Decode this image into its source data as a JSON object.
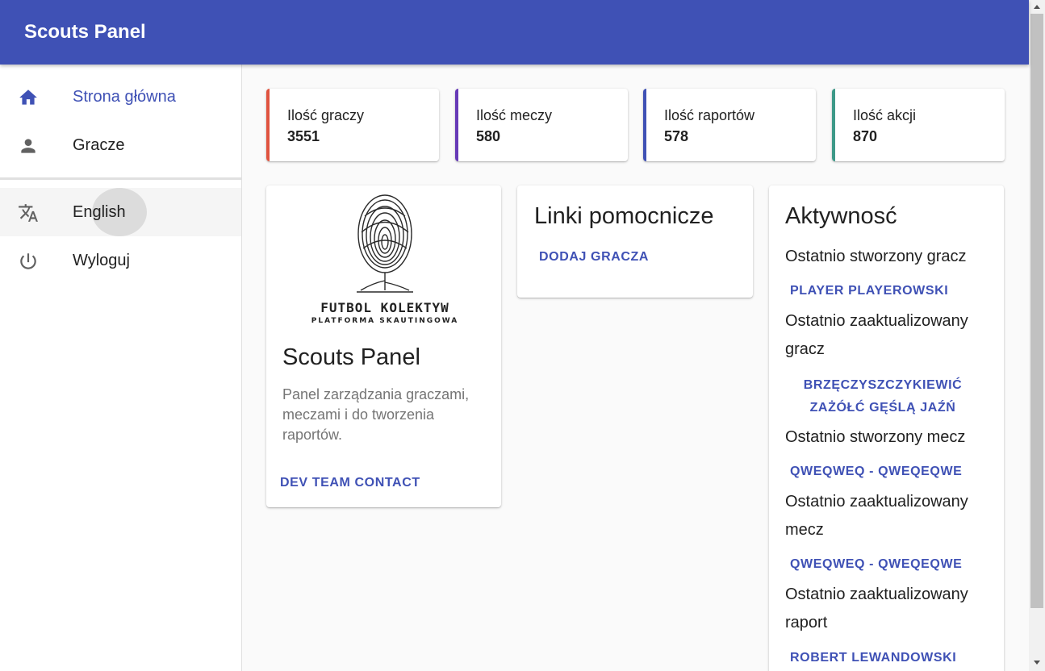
{
  "app": {
    "title": "Scouts Panel"
  },
  "sidebar": {
    "items": [
      {
        "label": "Strona główna",
        "icon": "home-icon",
        "active": true
      },
      {
        "label": "Gracze",
        "icon": "person-icon"
      },
      {
        "label": "English",
        "icon": "translate-icon"
      },
      {
        "label": "Wyloguj",
        "icon": "power-icon"
      }
    ]
  },
  "stats": [
    {
      "label": "Ilość graczy",
      "value": "3551",
      "color": "#e0533f"
    },
    {
      "label": "Ilość meczy",
      "value": "580",
      "color": "#673ab7"
    },
    {
      "label": "Ilość raportów",
      "value": "578",
      "color": "#3f51b5"
    },
    {
      "label": "Ilość akcji",
      "value": "870",
      "color": "#3d9988"
    }
  ],
  "about_card": {
    "logo_word": "FUTBOL KOLEKTYW",
    "logo_sub": "PLATFORMA SKAUTINGOWA",
    "title": "Scouts Panel",
    "description": "Panel zarządzania graczami, meczami i do tworzenia raportów.",
    "button": "Dev team contact"
  },
  "links_card": {
    "title": "Linki pomocnicze",
    "add_player": "Dodaj gracza"
  },
  "activity_card": {
    "title": "Aktywnosć",
    "created_player_label": "Ostatnio stworzony gracz",
    "created_player": "Player Playerowski",
    "updated_player_label": "Ostatnio zaaktualizowany gracz",
    "updated_player": "Brzęczyszczykiewić Zażółć Gęślą Jaźń",
    "created_match_label": "Ostatnio stworzony mecz",
    "created_match": "qweqweq - qweqeqwe",
    "updated_match_label": "Ostatnio zaaktualizowany mecz",
    "updated_match": "qweqweq - qweqeqwe",
    "updated_report_label": "Ostatnio zaaktualizowany raport",
    "updated_report": "Robert Lewandowski"
  },
  "colors": {
    "primary": "#3f51b5",
    "icon_gray": "#616161"
  }
}
